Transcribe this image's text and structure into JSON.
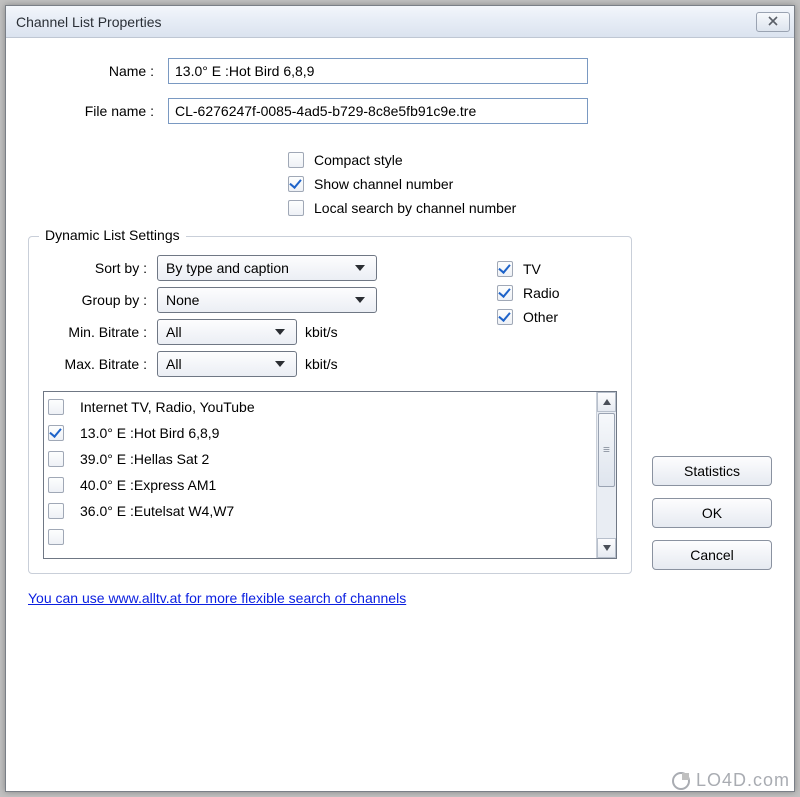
{
  "window": {
    "title": "Channel List Properties"
  },
  "fields": {
    "name_label": "Name :",
    "name_value": "13.0° E :Hot Bird 6,8,9",
    "filename_label": "File name :",
    "filename_value": "CL-6276247f-0085-4ad5-b729-8c8e5fb91c9e.tre"
  },
  "options": {
    "compact": {
      "label": "Compact style",
      "checked": false
    },
    "show_number": {
      "label": "Show channel number",
      "checked": true
    },
    "local_search": {
      "label": "Local search by channel number",
      "checked": false
    }
  },
  "dynamic": {
    "title": "Dynamic List Settings",
    "sort_label": "Sort by :",
    "sort_value": "By type and caption",
    "group_label": "Group by :",
    "group_value": "None",
    "min_bitrate_label": "Min. Bitrate :",
    "min_bitrate_value": "All",
    "max_bitrate_label": "Max. Bitrate :",
    "max_bitrate_value": "All",
    "bitrate_unit": "kbit/s",
    "type_filters": {
      "tv": {
        "label": "TV",
        "checked": true
      },
      "radio": {
        "label": "Radio",
        "checked": true
      },
      "other": {
        "label": "Other",
        "checked": true
      }
    },
    "list": [
      {
        "label": "Internet TV, Radio, YouTube",
        "checked": false
      },
      {
        "label": "13.0° E :Hot Bird 6,8,9",
        "checked": true
      },
      {
        "label": "39.0° E :Hellas Sat 2",
        "checked": false
      },
      {
        "label": "40.0° E :Express AM1",
        "checked": false
      },
      {
        "label": "36.0° E :Eutelsat W4,W7",
        "checked": false
      },
      {
        "label": "",
        "checked": false
      }
    ]
  },
  "buttons": {
    "statistics": "Statistics",
    "ok": "OK",
    "cancel": "Cancel"
  },
  "link": "You can use www.alltv.at for more flexible search of channels",
  "watermark": "LO4D.com"
}
